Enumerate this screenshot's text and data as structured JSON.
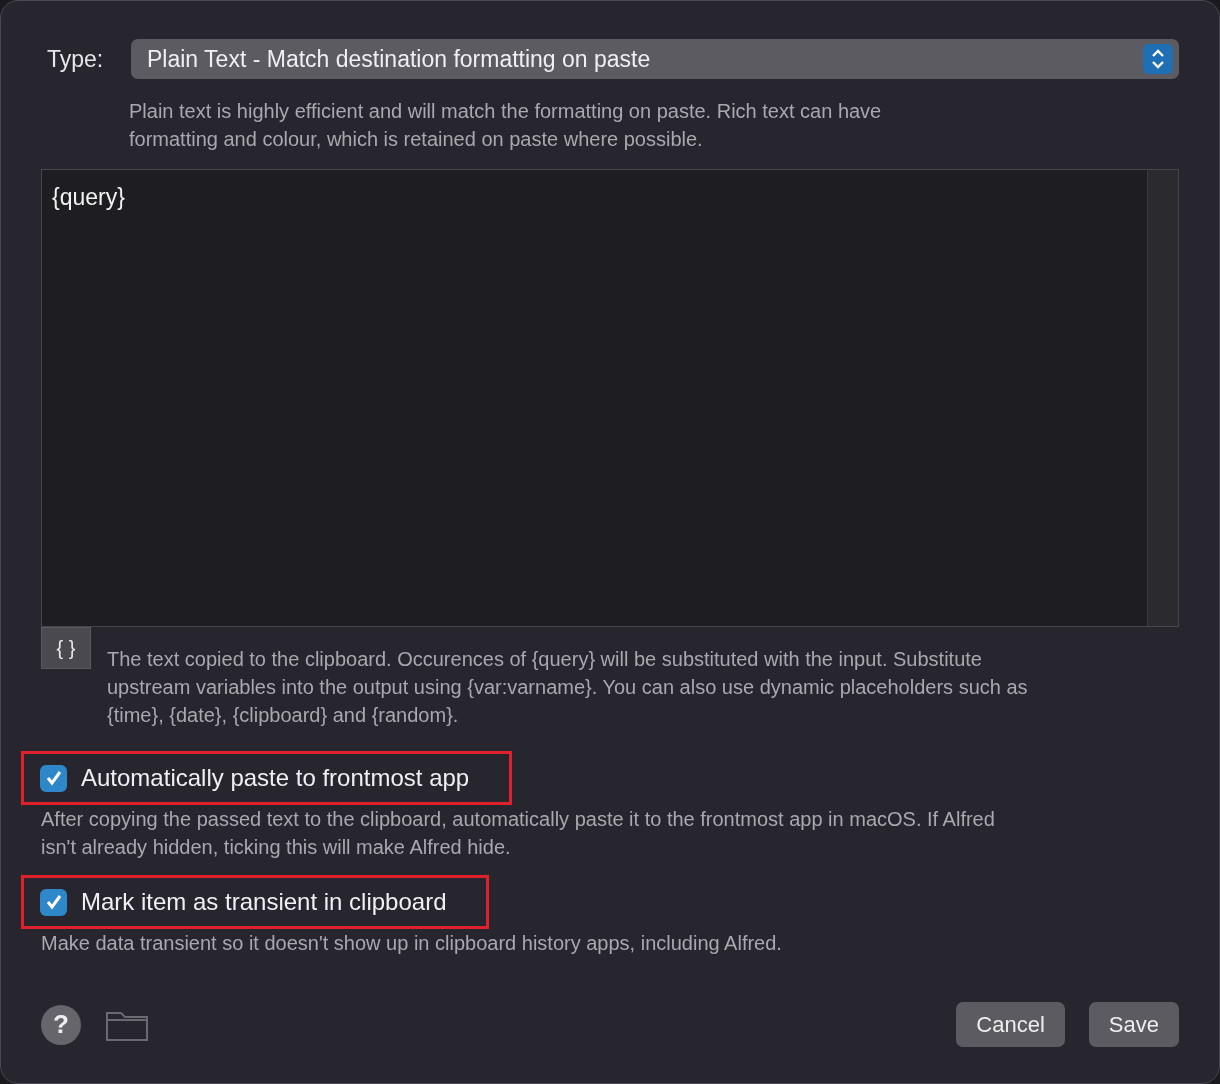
{
  "type_field": {
    "label": "Type:",
    "value": "Plain Text - Match destination formatting on paste",
    "help": "Plain text is highly efficient and will match the formatting on paste. Rich text can have formatting and colour, which is retained on paste where possible."
  },
  "editor": {
    "value": "{query}",
    "insert_button": "{ }",
    "help": "The text copied to the clipboard. Occurences of {query} will be substituted with the input. Substitute upstream variables into the output using {var:varname}. You can also use dynamic placeholders such as {time}, {date}, {clipboard} and {random}."
  },
  "options": [
    {
      "label": "Automatically paste to frontmost app",
      "checked": true,
      "highlighted": true,
      "help": "After copying the passed text to the clipboard, automatically paste it to the frontmost app in macOS. If Alfred isn't already hidden, ticking this will make Alfred hide."
    },
    {
      "label": "Mark item as transient in clipboard",
      "checked": true,
      "highlighted": true,
      "help": "Make data transient so it doesn't show up in clipboard history apps, including Alfred."
    }
  ],
  "footer": {
    "help_button": "?",
    "buttons": [
      "Cancel",
      "Save"
    ]
  }
}
